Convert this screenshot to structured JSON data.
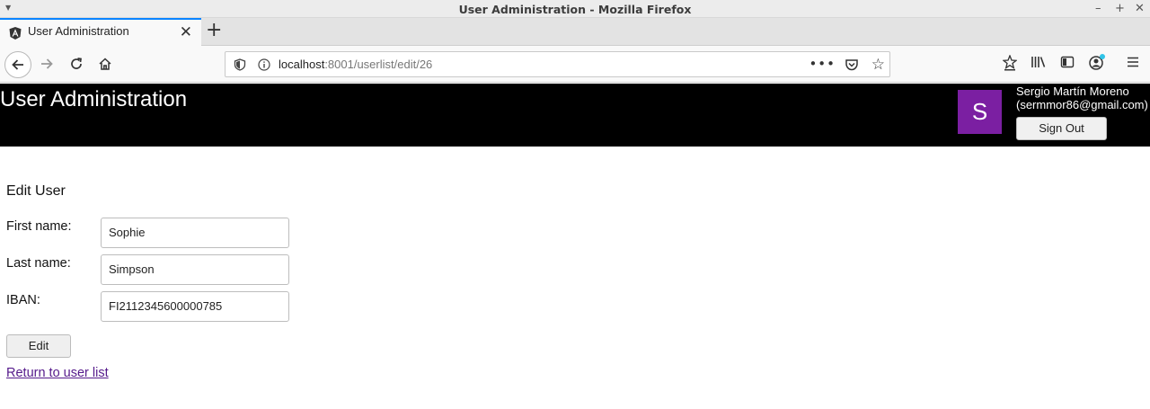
{
  "window": {
    "title": "User Administration - Mozilla Firefox"
  },
  "tab": {
    "label": "User  Administration"
  },
  "urlbar": {
    "host": "localhost",
    "path": ":8001/userlist/edit/26"
  },
  "header": {
    "app_title": "User Administration",
    "avatar_letter": "S",
    "user_name": "Sergio Martín Moreno",
    "user_email": "(sermmor86@gmail.com)",
    "signout_label": "Sign Out"
  },
  "form": {
    "title": "Edit User",
    "first_name_label": "First name:",
    "first_name_value": "Sophie",
    "last_name_label": "Last name:",
    "last_name_value": "Simpson",
    "iban_label": "IBAN:",
    "iban_value": "FI2112345600000785",
    "edit_label": "Edit",
    "return_link": "Return to user list"
  },
  "colors": {
    "header_bg": "#000000",
    "avatar_bg": "#7b1fa2",
    "link": "#551a8b",
    "tab_accent": "#0a84ff"
  }
}
